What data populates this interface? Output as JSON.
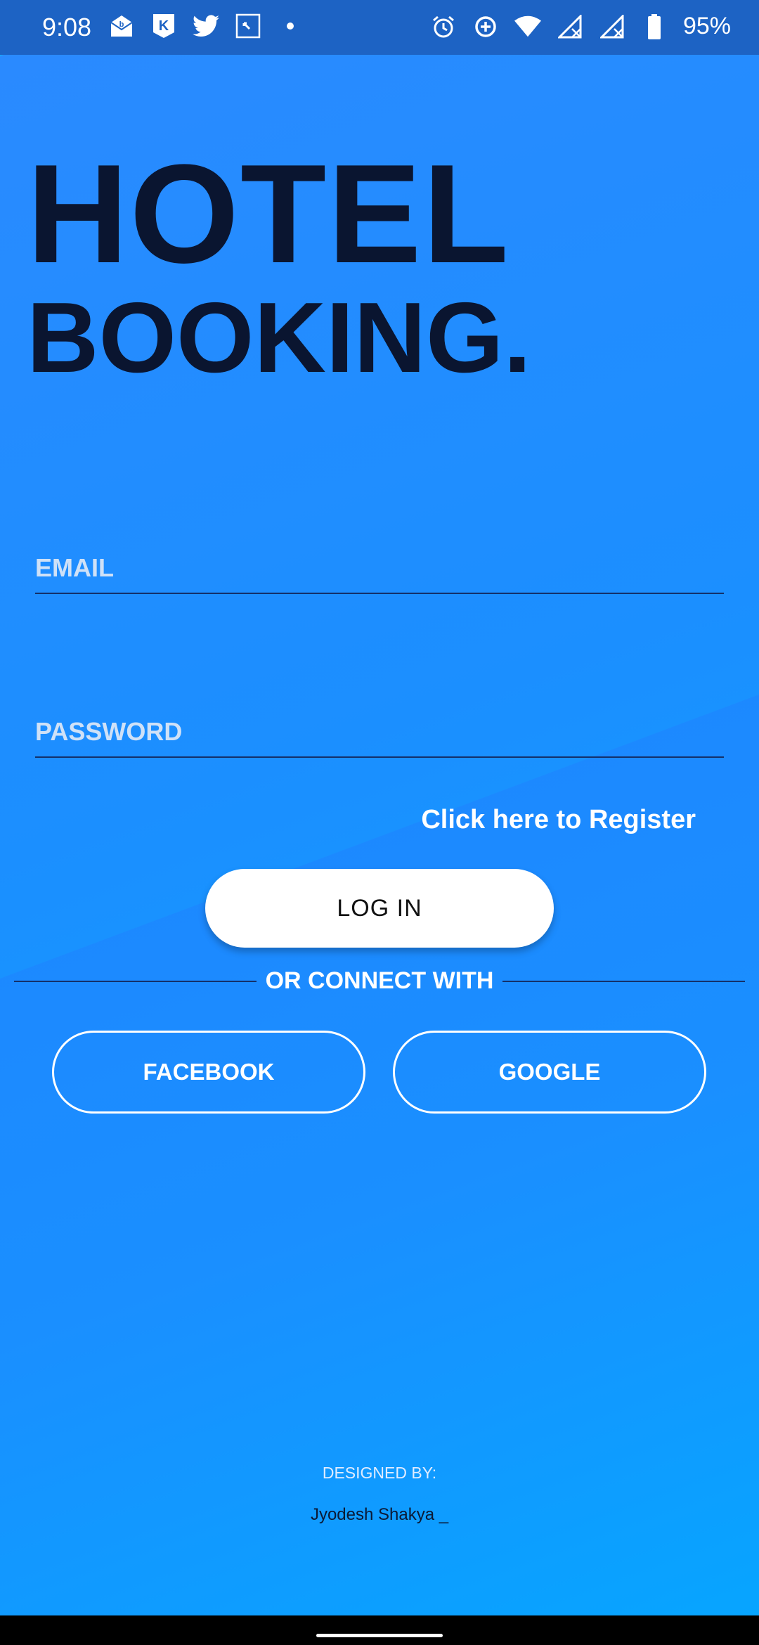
{
  "status_bar": {
    "time": "9:08",
    "left_icons": [
      "mail-b-icon",
      "kik-icon",
      "twitter-icon",
      "photo-icon",
      "dot-icon"
    ],
    "right_icons": [
      "alarm-icon",
      "data-saver-icon",
      "wifi-icon",
      "signal-1-icon",
      "signal-2-icon",
      "battery-icon"
    ],
    "battery": "95%"
  },
  "title": {
    "line1": "HOTEL",
    "line2": "BOOKING."
  },
  "form": {
    "email_placeholder": "EMAIL",
    "password_placeholder": "PASSWORD",
    "email_value": "",
    "password_value": "",
    "register_link": "Click here to Register",
    "login_button": "LOG IN"
  },
  "social": {
    "divider_text": "OR CONNECT WITH",
    "facebook": "FACEBOOK",
    "google": "GOOGLE"
  },
  "footer": {
    "designed_by": "DESIGNED BY:",
    "author": "Jyodesh Shakya _"
  },
  "colors": {
    "accent": "#1e86ff",
    "title": "#0a1530",
    "status_bar": "#1d63c4"
  }
}
